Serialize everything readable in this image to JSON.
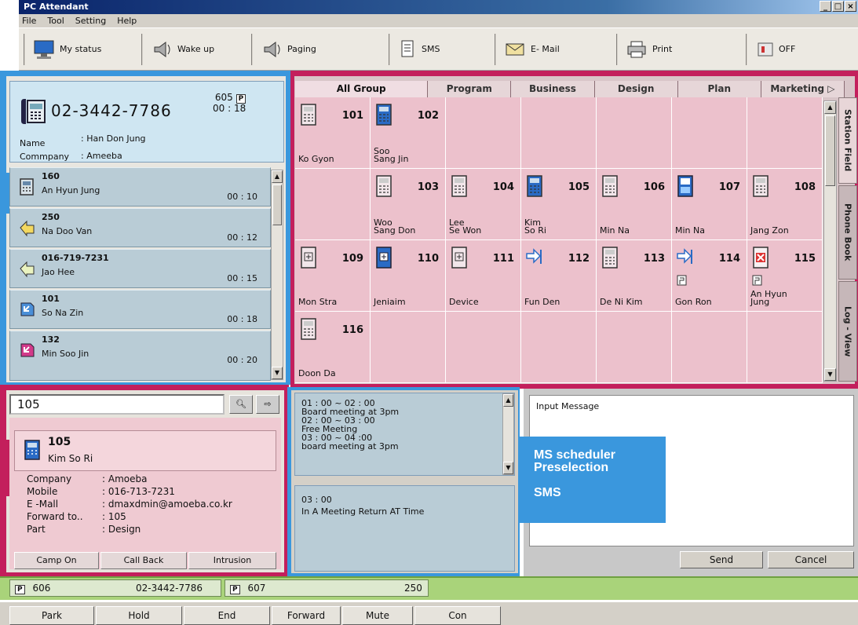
{
  "window": {
    "title": "PC Attendant",
    "controls": [
      "_",
      "□",
      "×"
    ]
  },
  "menu": [
    "File",
    "Tool",
    "Setting",
    "Help"
  ],
  "toolbar": [
    {
      "label": "My status",
      "icon": "monitor-icon"
    },
    {
      "label": "Wake up",
      "icon": "speaker-icon"
    },
    {
      "label": "Paging",
      "icon": "speaker-icon"
    },
    {
      "label": "SMS",
      "icon": "document-icon"
    },
    {
      "label": "E- Mail",
      "icon": "envelope-icon"
    },
    {
      "label": "Print",
      "icon": "printer-icon"
    },
    {
      "label": "OFF",
      "icon": "power-icon"
    }
  ],
  "active_call": {
    "number": "02-3442-7786",
    "extension": "605",
    "badge": "P",
    "duration": "00 : 18",
    "name_label": "Name",
    "name_value": ": Han Don Jung",
    "company_label": "Commpany",
    "company_value": ": Ameeba"
  },
  "queue": [
    {
      "number": "160",
      "name": "An Hyun Jung",
      "time": "00 : 10",
      "icon": "phone-icon"
    },
    {
      "number": "250",
      "name": "Na Doo Van",
      "time": "00 : 12",
      "icon": "transfer-icon"
    },
    {
      "number": "016-719-7231",
      "name": "Jao Hee",
      "time": "00 : 15",
      "icon": "transfer-icon"
    },
    {
      "number": "101",
      "name": "So Na Zin",
      "time": "00 : 18",
      "icon": "callback-icon"
    },
    {
      "number": "132",
      "name": "Min Soo Jin",
      "time": "00 : 20",
      "icon": "callback-icon"
    }
  ],
  "group_tabs": [
    "All Group",
    "Program",
    "Business",
    "Design",
    "Plan",
    "Marketing"
  ],
  "side_tabs": [
    "Station Field",
    "Phone Book",
    "Log - View"
  ],
  "stations": [
    {
      "ext": "101",
      "name": "Ko Gyon",
      "state": "idle"
    },
    {
      "ext": "102",
      "name": "Soo\nSang Jin",
      "state": "busy"
    },
    {
      "ext": "",
      "name": "",
      "state": "empty"
    },
    {
      "ext": "",
      "name": "",
      "state": "empty"
    },
    {
      "ext": "",
      "name": "",
      "state": "empty"
    },
    {
      "ext": "",
      "name": "",
      "state": "empty"
    },
    {
      "ext": "",
      "name": "",
      "state": "empty"
    },
    {
      "ext": "",
      "name": "",
      "state": "empty"
    },
    {
      "ext": "103",
      "name": "Woo\nSang Don",
      "state": "idle"
    },
    {
      "ext": "104",
      "name": "Lee\nSe Won",
      "state": "idle"
    },
    {
      "ext": "105",
      "name": "Kim\nSo Ri",
      "state": "busy"
    },
    {
      "ext": "106",
      "name": "Min Na",
      "state": "idle"
    },
    {
      "ext": "107",
      "name": "Min Na",
      "state": "ringing"
    },
    {
      "ext": "108",
      "name": "Jang Zon",
      "state": "idle"
    },
    {
      "ext": "109",
      "name": "Mon Stra",
      "state": "dnd"
    },
    {
      "ext": "110",
      "name": "Jeniaim",
      "state": "dnd-busy"
    },
    {
      "ext": "111",
      "name": "Device",
      "state": "dnd"
    },
    {
      "ext": "112",
      "name": "Fun Den",
      "state": "forward"
    },
    {
      "ext": "113",
      "name": "De Ni Kim",
      "state": "idle"
    },
    {
      "ext": "114",
      "name": "Gon Ron",
      "state": "forward-p"
    },
    {
      "ext": "115",
      "name": "An Hyun\nJung",
      "state": "error-p"
    },
    {
      "ext": "116",
      "name": "Doon Da",
      "state": "idle"
    }
  ],
  "search": {
    "value": "105"
  },
  "detail": {
    "ext": "105",
    "name": "Kim So Ri",
    "fields": [
      {
        "label": "Company",
        "value": ": Amoeba"
      },
      {
        "label": "Mobile",
        "value": ": 016-713-7231"
      },
      {
        "label": "E -Mall",
        "value": ": dmaxdmin@amoeba.co.kr"
      },
      {
        "label": "Forward to..",
        "value": ": 105"
      },
      {
        "label": "Part",
        "value": ": Design"
      }
    ],
    "buttons": [
      "Camp On",
      "Call Back",
      "Intrusion"
    ]
  },
  "schedule": {
    "top": "01 : 00 ~ 02 : 00\nBoard meeting at 3pm\n02 : 00 ~ 03 : 00\nFree Meeting\n03 : 00 ~ 04 :00\nboard meeting at 3pm",
    "bottom_time": "03 : 00",
    "bottom_text": "In A Meeting Return AT Time"
  },
  "callout": [
    "MS scheduler",
    "Preselection",
    "SMS"
  ],
  "sms": {
    "placeholder": "Input Message",
    "send": "Send",
    "cancel": "Cancel"
  },
  "status": {
    "park1": "606",
    "park1_number": "02-3442-7786",
    "park2": "607",
    "park2_number": "250",
    "badge": "P"
  },
  "footer": [
    "Park",
    "Hold",
    "End",
    "Forward",
    "Mute",
    "Con"
  ]
}
